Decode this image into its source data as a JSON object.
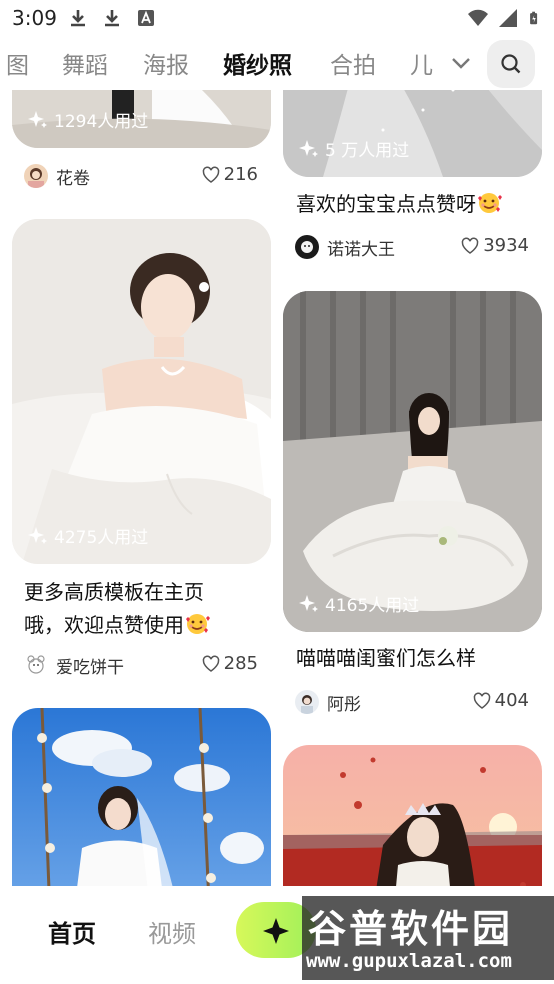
{
  "status": {
    "time": "3:09"
  },
  "tabs": [
    {
      "label": "图",
      "active": false
    },
    {
      "label": "舞蹈",
      "active": false
    },
    {
      "label": "海报",
      "active": false
    },
    {
      "label": "婚纱照",
      "active": true
    },
    {
      "label": "合拍",
      "active": false
    },
    {
      "label": "儿",
      "active": false
    }
  ],
  "icons": {
    "search": "search-icon",
    "chevron": "chevron-down-icon",
    "sparkle": "sparkle-icon",
    "heart": "heart-icon"
  },
  "colors": {
    "accent": "#b8f25a",
    "create_gradient_start": "#d7f85a",
    "create_gradient_end": "#9ff05a"
  },
  "feed": {
    "left": [
      {
        "used": "1294人用过",
        "author": "花卷",
        "likes": "216"
      },
      {
        "used": "4275人用过",
        "title_line1": "更多高质模板在主页",
        "title_line2": "哦，欢迎点赞使用",
        "title_emoji": "smiling-face-with-hearts",
        "author": "爱吃饼干",
        "likes": "285"
      },
      {
        "used": ""
      }
    ],
    "right": [
      {
        "used": "5 万人用过",
        "title": "喜欢的宝宝点点赞呀",
        "title_emoji": "smiling-face-with-hearts",
        "author": "诺诺大王",
        "likes": "3934"
      },
      {
        "used": "4165人用过",
        "title": "喵喵喵闺蜜们怎么样",
        "author": "阿彤",
        "likes": "404"
      },
      {
        "used": ""
      }
    ]
  },
  "bottom_nav": {
    "home": "首页",
    "video": "视频",
    "create_icon": "sparkle-icon"
  },
  "watermark": {
    "logo": "谷普软件园",
    "url": "www.gupuxlazal.com"
  }
}
